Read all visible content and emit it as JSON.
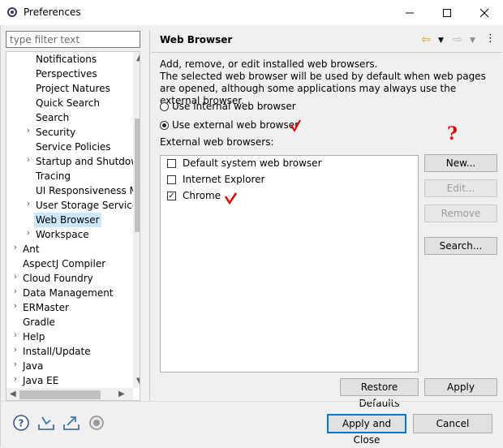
{
  "window": {
    "title": "Preferences"
  },
  "filter": {
    "placeholder": "type filter text"
  },
  "tree": {
    "items": [
      {
        "label": "Notifications",
        "indent": 2,
        "twisty": false
      },
      {
        "label": "Perspectives",
        "indent": 2,
        "twisty": false
      },
      {
        "label": "Project Natures",
        "indent": 2,
        "twisty": false
      },
      {
        "label": "Quick Search",
        "indent": 2,
        "twisty": false
      },
      {
        "label": "Search",
        "indent": 2,
        "twisty": false
      },
      {
        "label": "Security",
        "indent": 2,
        "twisty": true
      },
      {
        "label": "Service Policies",
        "indent": 2,
        "twisty": false
      },
      {
        "label": "Startup and Shutdown",
        "indent": 2,
        "twisty": true
      },
      {
        "label": "Tracing",
        "indent": 2,
        "twisty": false
      },
      {
        "label": "UI Responsiveness Monitoring",
        "indent": 2,
        "twisty": false
      },
      {
        "label": "User Storage Service",
        "indent": 2,
        "twisty": true
      },
      {
        "label": "Web Browser",
        "indent": 2,
        "twisty": false,
        "selected": true
      },
      {
        "label": "Workspace",
        "indent": 2,
        "twisty": true
      },
      {
        "label": "Ant",
        "indent": 1,
        "twisty": true
      },
      {
        "label": "AspectJ Compiler",
        "indent": 1,
        "twisty": false
      },
      {
        "label": "Cloud Foundry",
        "indent": 1,
        "twisty": true
      },
      {
        "label": "Data Management",
        "indent": 1,
        "twisty": true
      },
      {
        "label": "ERMaster",
        "indent": 1,
        "twisty": true
      },
      {
        "label": "Gradle",
        "indent": 1,
        "twisty": false
      },
      {
        "label": "Help",
        "indent": 1,
        "twisty": true
      },
      {
        "label": "Install/Update",
        "indent": 1,
        "twisty": true
      },
      {
        "label": "Java",
        "indent": 1,
        "twisty": true
      },
      {
        "label": "Java EE",
        "indent": 1,
        "twisty": true
      }
    ]
  },
  "page": {
    "title": "Web Browser",
    "description": "Add, remove, or edit installed web browsers.\nThe selected web browser will be used by default when web pages are opened, although some applications may always use the external browser.",
    "radio_internal": "Use internal web browser",
    "radio_external": "Use external web browser",
    "list_label": "External web browsers:",
    "browsers": [
      {
        "label": "Default system web browser",
        "checked": false
      },
      {
        "label": "Internet Explorer",
        "checked": false
      },
      {
        "label": "Chrome",
        "checked": true
      }
    ],
    "buttons": {
      "new": "New...",
      "edit": "Edit...",
      "remove": "Remove",
      "search": "Search..."
    },
    "restore_defaults": "Restore Defaults",
    "apply": "Apply"
  },
  "footer": {
    "apply_close": "Apply and Close",
    "cancel": "Cancel"
  },
  "annotations": {
    "question": "?"
  },
  "colors": {
    "selection": "#cce8ff",
    "default_button_border": "#0078d7",
    "annotation": "#e00000"
  }
}
